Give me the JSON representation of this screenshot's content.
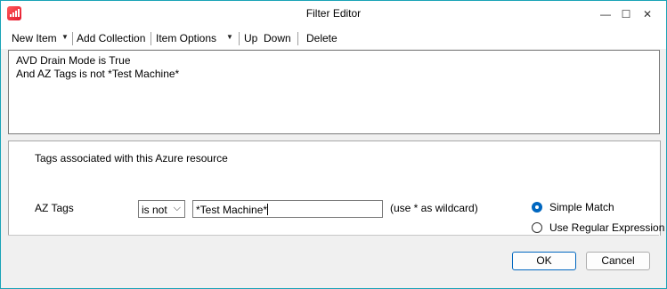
{
  "window": {
    "title": "Filter Editor",
    "controls": {
      "minimize": "—",
      "maximize": "☐",
      "close": "✕"
    }
  },
  "menu": {
    "new_item": "New Item",
    "add_collection": "Add Collection",
    "item_options": "Item Options",
    "up": "Up",
    "down": "Down",
    "delete": "Delete",
    "dropdown_glyph": "▼"
  },
  "rules": [
    "AVD Drain Mode is True",
    "And AZ Tags is not *Test Machine*"
  ],
  "editor": {
    "description": "Tags associated with this Azure resource",
    "field_label": "AZ Tags",
    "operator": "is not",
    "operator_chevron": "⌵",
    "value": "*Test Machine*",
    "hint": "(use * as wildcard)",
    "match_options": [
      {
        "label": "Simple Match",
        "selected": true
      },
      {
        "label": "Use Regular Expression",
        "selected": false
      }
    ]
  },
  "buttons": {
    "ok": "OK",
    "cancel": "Cancel"
  },
  "colors": {
    "accent": "#0067c0",
    "window_border": "#1aa3b7",
    "icon": "#e3182d"
  }
}
